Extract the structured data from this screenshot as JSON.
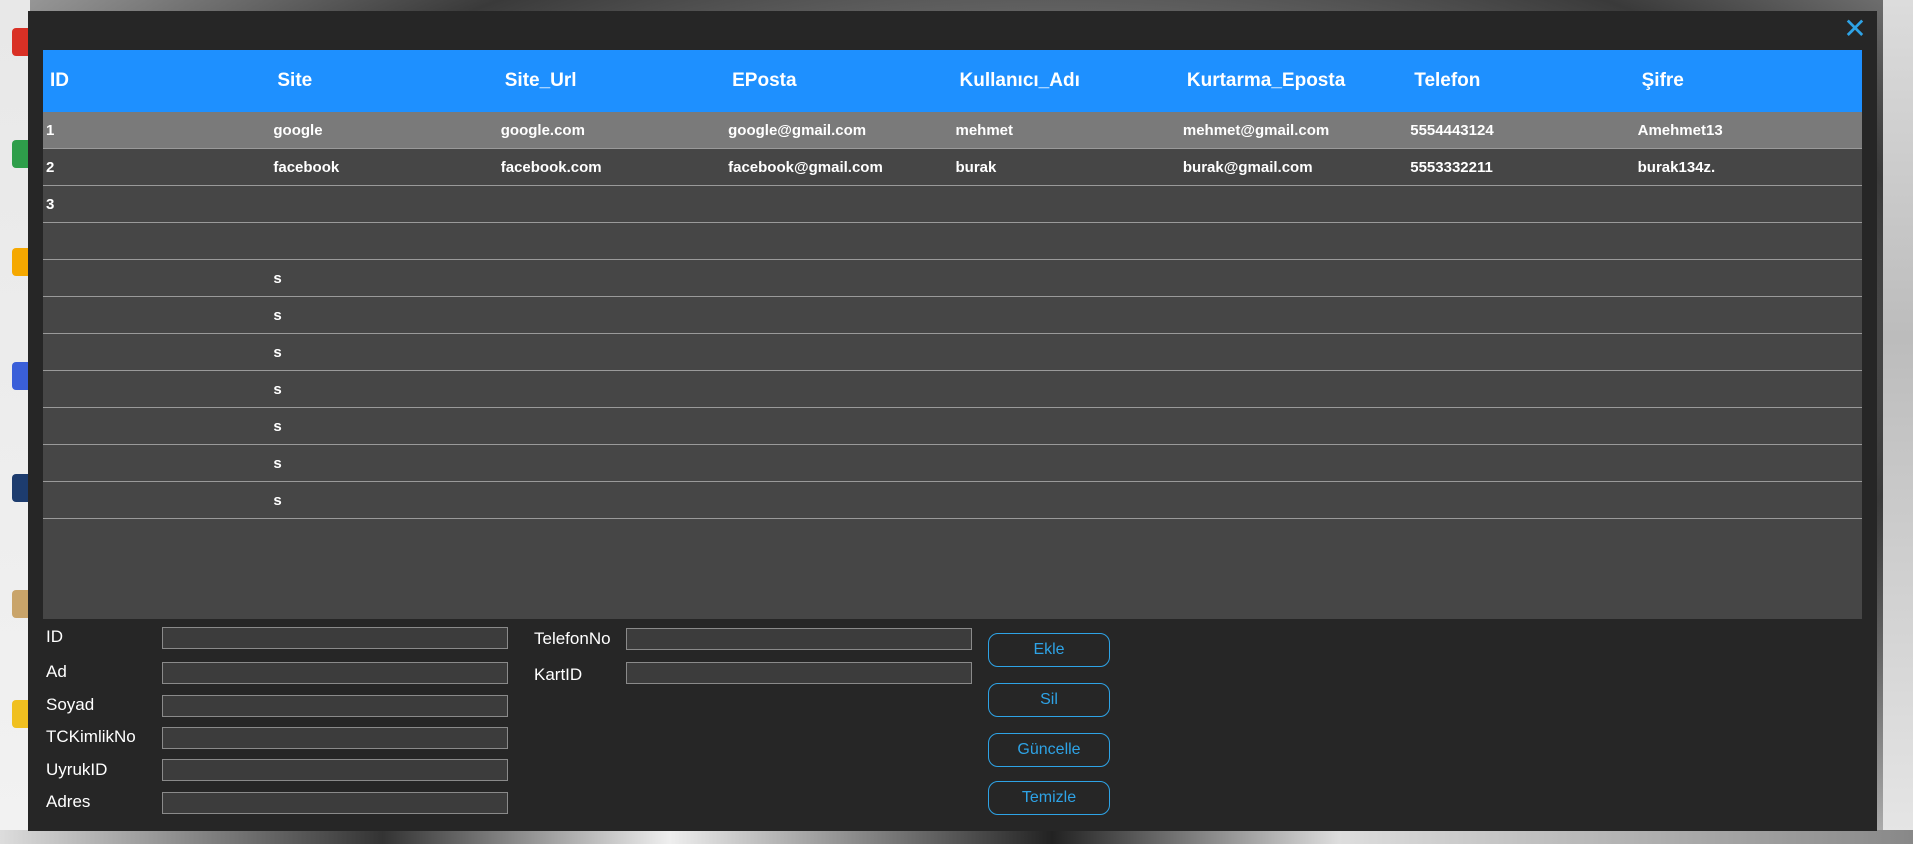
{
  "window": {
    "close_icon": "close-icon"
  },
  "grid": {
    "columns": [
      "ID",
      "Site",
      "Site_Url",
      "EPosta",
      "Kullanıcı_Adı",
      "Kurtarma_Eposta",
      "Telefon",
      "Şifre"
    ],
    "rows": [
      [
        "1",
        "google",
        "google.com",
        "google@gmail.com",
        "mehmet",
        "mehmet@gmail.com",
        "5554443124",
        "Amehmet13"
      ],
      [
        "2",
        "facebook",
        "facebook.com",
        "facebook@gmail.com",
        "burak",
        "burak@gmail.com",
        "5553332211",
        "burak134z."
      ],
      [
        "3",
        "",
        "",
        "",
        "",
        "",
        "",
        ""
      ],
      [
        "",
        "",
        "",
        "",
        "",
        "",
        "",
        ""
      ],
      [
        "",
        "s",
        "",
        "",
        "",
        "",
        "",
        ""
      ],
      [
        "",
        "s",
        "",
        "",
        "",
        "",
        "",
        ""
      ],
      [
        "",
        "s",
        "",
        "",
        "",
        "",
        "",
        ""
      ],
      [
        "",
        "s",
        "",
        "",
        "",
        "",
        "",
        ""
      ],
      [
        "",
        "s",
        "",
        "",
        "",
        "",
        "",
        ""
      ],
      [
        "",
        "s",
        "",
        "",
        "",
        "",
        "",
        ""
      ],
      [
        "",
        "s",
        "",
        "",
        "",
        "",
        "",
        ""
      ]
    ],
    "selected_row": 0
  },
  "form": {
    "id_label": "ID",
    "ad_label": "Ad",
    "soyad_label": "Soyad",
    "tc_label": "TCKimlikNo",
    "uyruk_label": "UyrukID",
    "adres_label": "Adres",
    "telefon_label": "TelefonNo",
    "kart_label": "KartID",
    "id_value": "",
    "ad_value": "",
    "soyad_value": "",
    "tc_value": "",
    "uyruk_value": "",
    "adres_value": "",
    "telefon_value": "",
    "kart_value": ""
  },
  "buttons": {
    "ekle": "Ekle",
    "sil": "Sil",
    "guncelle": "Güncelle",
    "temizle": "Temizle"
  },
  "colors": {
    "header": "#1e90ff",
    "accent": "#2ea3e6",
    "window_bg": "#262626",
    "grid_bg": "#464646",
    "selected_row": "#7a7a7a"
  }
}
